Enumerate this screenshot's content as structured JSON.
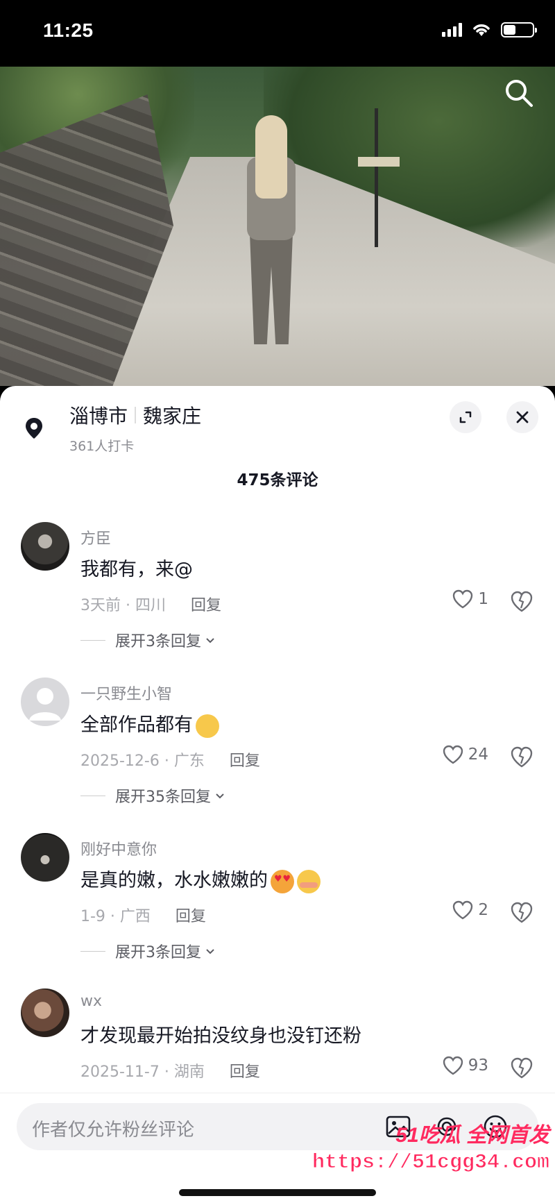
{
  "status": {
    "time": "11:25"
  },
  "location": {
    "city": "淄博市",
    "place": "魏家庄",
    "checkins": "361人打卡"
  },
  "comments_count": "475条评论",
  "comments": [
    {
      "name": "方臣",
      "text": "我都有，来@",
      "meta": "3天前 · 四川",
      "reply": "回复",
      "likes": "1",
      "expand": "展开3条回复"
    },
    {
      "name": "一只野生小智",
      "text": "全部作品都有",
      "meta": "2025-12-6 · 广东",
      "reply": "回复",
      "likes": "24",
      "expand": "展开35条回复"
    },
    {
      "name": "刚好中意你",
      "text": "是真的嫩，水水嫩嫩的",
      "meta": "1-9 · 广西",
      "reply": "回复",
      "likes": "2",
      "expand": "展开3条回复"
    },
    {
      "name": "wx",
      "text": "才发现最开始拍没纹身也没钉还粉",
      "meta": "2025-11-7 · 湖南",
      "reply": "回复",
      "likes": "93"
    }
  ],
  "input": {
    "placeholder": "作者仅允许粉丝评论"
  },
  "watermark": {
    "brand": "51吃瓜 全网首发",
    "url": "https://51cgg34.com"
  },
  "colors": {
    "accent": "#ff2a5f",
    "text": "#161823",
    "muted": "#8a8b91"
  }
}
